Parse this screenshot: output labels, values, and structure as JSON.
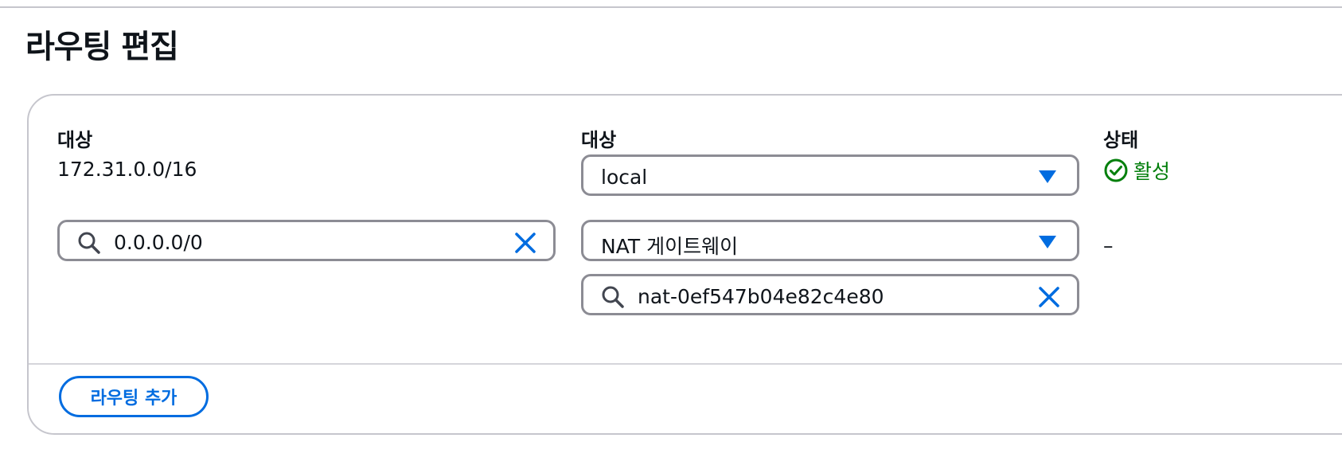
{
  "page": {
    "title": "라우팅 편집"
  },
  "columns": {
    "destination": "대상",
    "target": "대상",
    "status": "상태"
  },
  "routes": [
    {
      "destination": "172.31.0.0/16",
      "target": "local",
      "status": "활성"
    },
    {
      "destination": "0.0.0.0/0",
      "target": "NAT 게이트웨이",
      "target_id": "nat-0ef547b04e82c4e80",
      "status": "–"
    }
  ],
  "actions": {
    "add_route": "라우팅 추가"
  },
  "icons": {
    "search": "search-icon",
    "clear": "close-icon",
    "dropdown": "caret-down-icon",
    "status_ok": "check-circle-icon"
  },
  "colors": {
    "accent": "#006ce0",
    "success": "#037f0c",
    "border": "#8c8c94"
  }
}
